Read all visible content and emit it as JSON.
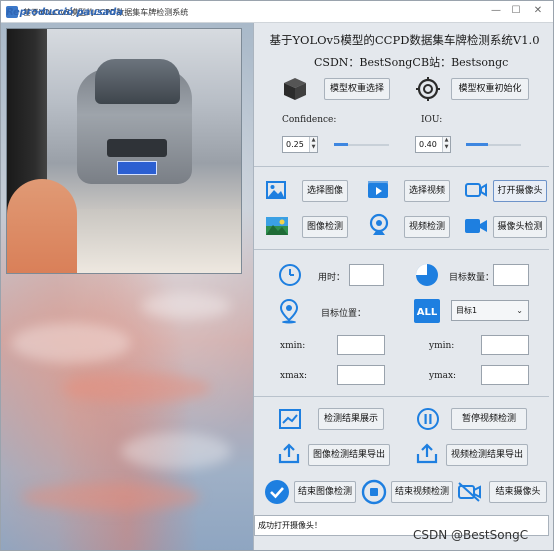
{
  "window": {
    "title": "基于YOLOv5模型的CCPD数据集车牌检测系统",
    "overlay_label": "Reproducció pausada",
    "controls": [
      "—",
      "☐",
      "✕"
    ]
  },
  "header": {
    "title": "基于YOLOv5模型的CCPD数据集车牌检测系统V1.0",
    "csdn_label": "CSDN：BestSongC",
    "bilibili_label": "B站：Bestsongc"
  },
  "model": {
    "select_weights_label": "模型权重选择",
    "init_weights_label": "模型权重初始化"
  },
  "params": {
    "confidence_label": "Confidence:",
    "confidence_value": "0.25",
    "iou_label": "IOU:",
    "iou_value": "0.40",
    "confidence_fraction": 0.25,
    "iou_fraction": 0.4
  },
  "inputs": {
    "select_image_label": "选择图像",
    "select_video_label": "选择视频",
    "open_camera_label": "打开摄像头",
    "image_detect_label": "图像检测",
    "video_detect_label": "视频检测",
    "camera_detect_label": "摄像头检测"
  },
  "results": {
    "time_label": "用时：",
    "time_value": "",
    "count_label": "目标数量：",
    "count_value": "",
    "position_label": "目标位置：",
    "target_select_value": "目标1",
    "xmin_label": "xmin:",
    "ymin_label": "ymin:",
    "xmax_label": "xmax:",
    "ymax_label": "ymax:",
    "xmin_value": "",
    "ymin_value": "",
    "xmax_value": "",
    "ymax_value": ""
  },
  "actions": {
    "show_results_label": "检测结果展示",
    "pause_video_label": "暂停视频检测",
    "export_image_label": "图像检测结果导出",
    "export_video_label": "视频检测结果导出",
    "end_image_label": "结束图像检测",
    "end_video_label": "结束视频检测",
    "end_camera_label": "结束摄像头"
  },
  "status": {
    "message": "成功打开摄像头！"
  },
  "watermark": "CSDN @BestSongC",
  "colors": {
    "accent": "#1e7fe0",
    "icon_dark": "#2b2b2b",
    "panel_bg": "#e4e8ed"
  }
}
